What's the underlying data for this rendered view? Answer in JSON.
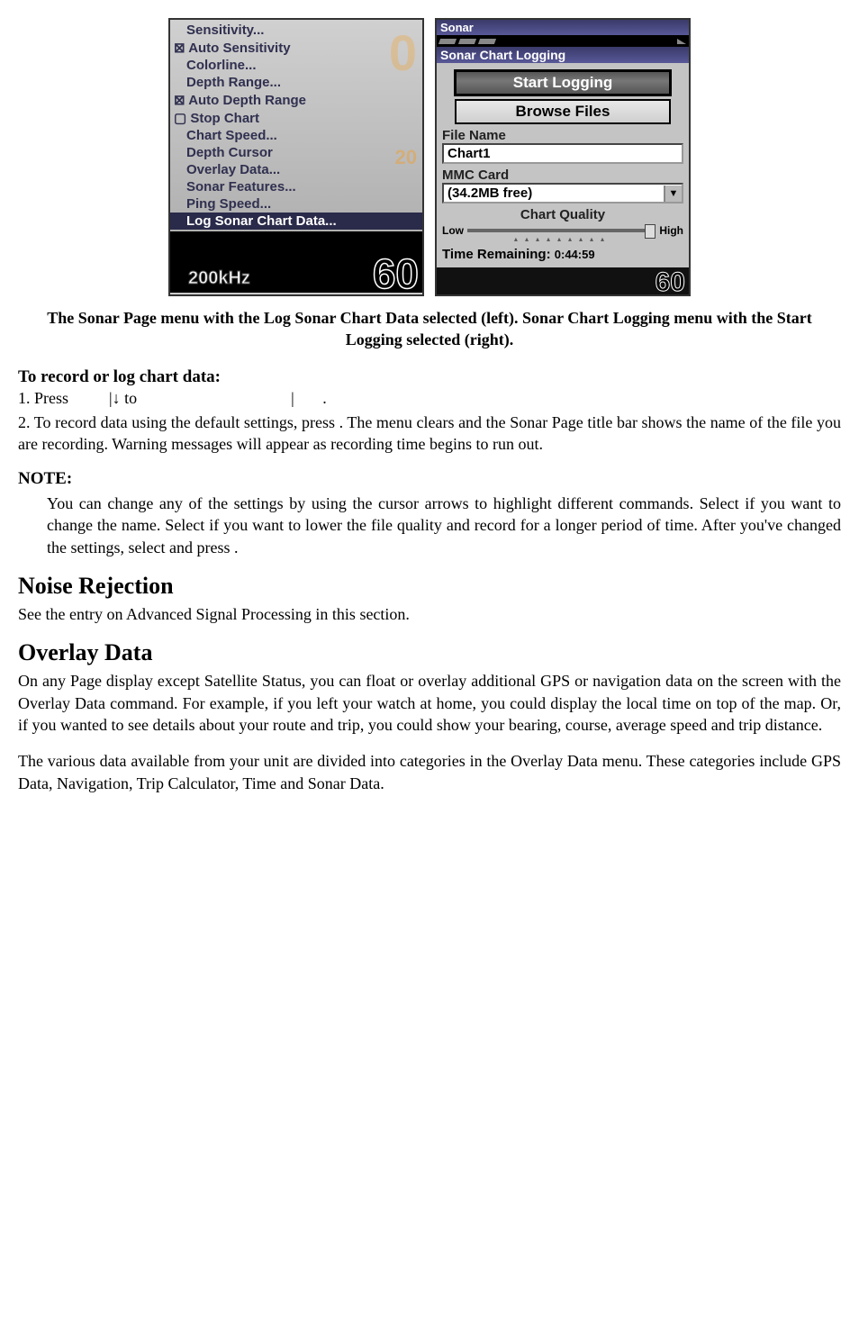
{
  "left_menu": {
    "items": [
      {
        "label": "Sensitivity...",
        "cls": "indent"
      },
      {
        "label": "Auto Sensitivity",
        "cls": "check"
      },
      {
        "label": "Colorline...",
        "cls": "indent"
      },
      {
        "label": "Depth Range...",
        "cls": "indent"
      },
      {
        "label": "Auto Depth Range",
        "cls": "check"
      },
      {
        "label": "Stop Chart",
        "cls": "uncheck"
      },
      {
        "label": "Chart Speed...",
        "cls": "indent"
      },
      {
        "label": "Depth Cursor",
        "cls": "indent"
      },
      {
        "label": "Overlay Data...",
        "cls": "indent"
      },
      {
        "label": "Sonar Features...",
        "cls": "indent"
      },
      {
        "label": "Ping Speed...",
        "cls": "indent"
      },
      {
        "label": "Log Sonar Chart Data...",
        "cls": "selected indent"
      }
    ],
    "khz": "200kHz",
    "big": "60",
    "faded0": "0",
    "faded20": "20"
  },
  "right": {
    "title": "Sonar",
    "sub": "Sonar Chart Logging",
    "btn_start": "Start Logging",
    "btn_browse": "Browse Files",
    "lbl_file": "File Name",
    "val_file": "Chart1",
    "lbl_card": "MMC Card",
    "val_card": "(34.2MB free)",
    "lbl_quality": "Chart Quality",
    "low": "Low",
    "high": "High",
    "time_lbl": "Time Remaining:",
    "time_val": "0:44:59",
    "big": "60"
  },
  "caption": "The Sonar Page menu with the Log Sonar Chart Data selected (left). Sonar Chart Logging menu with the Start Logging selected (right).",
  "h_record": "To record or log chart data:",
  "step1_a": "1. Press ",
  "step1_b": "|↓ to ",
  "step1_c": "|",
  "step1_d": ".",
  "p2": "2. To record data using the default settings, press       . The menu clears and the Sonar Page title bar shows the name of the file you are recording. Warning messages will appear as recording time begins to run out.",
  "note_h": "NOTE:",
  "note_body": "You can change any of the settings by using the cursor arrows to highlight different commands. Select                  if you want to change the name. Select                       if you want to lower the file quality and record for a longer period of time. After you've changed the settings, select                        and press        .",
  "h_noise": "Noise Rejection",
  "p_noise": "See the entry on Advanced Signal Processing in this section.",
  "h_overlay": "Overlay Data",
  "p_overlay1": "On any Page display except Satellite Status, you can float or overlay additional GPS or navigation data on the screen with the Overlay Data command. For example, if you left your watch at home, you could display the local time on top of the map. Or, if you wanted to see details about your route and trip, you could show your bearing, course, average speed and trip distance.",
  "p_overlay2": "The various data available from your unit are divided into categories in the Overlay Data menu. These categories include GPS Data, Navigation, Trip Calculator, Time and Sonar Data."
}
